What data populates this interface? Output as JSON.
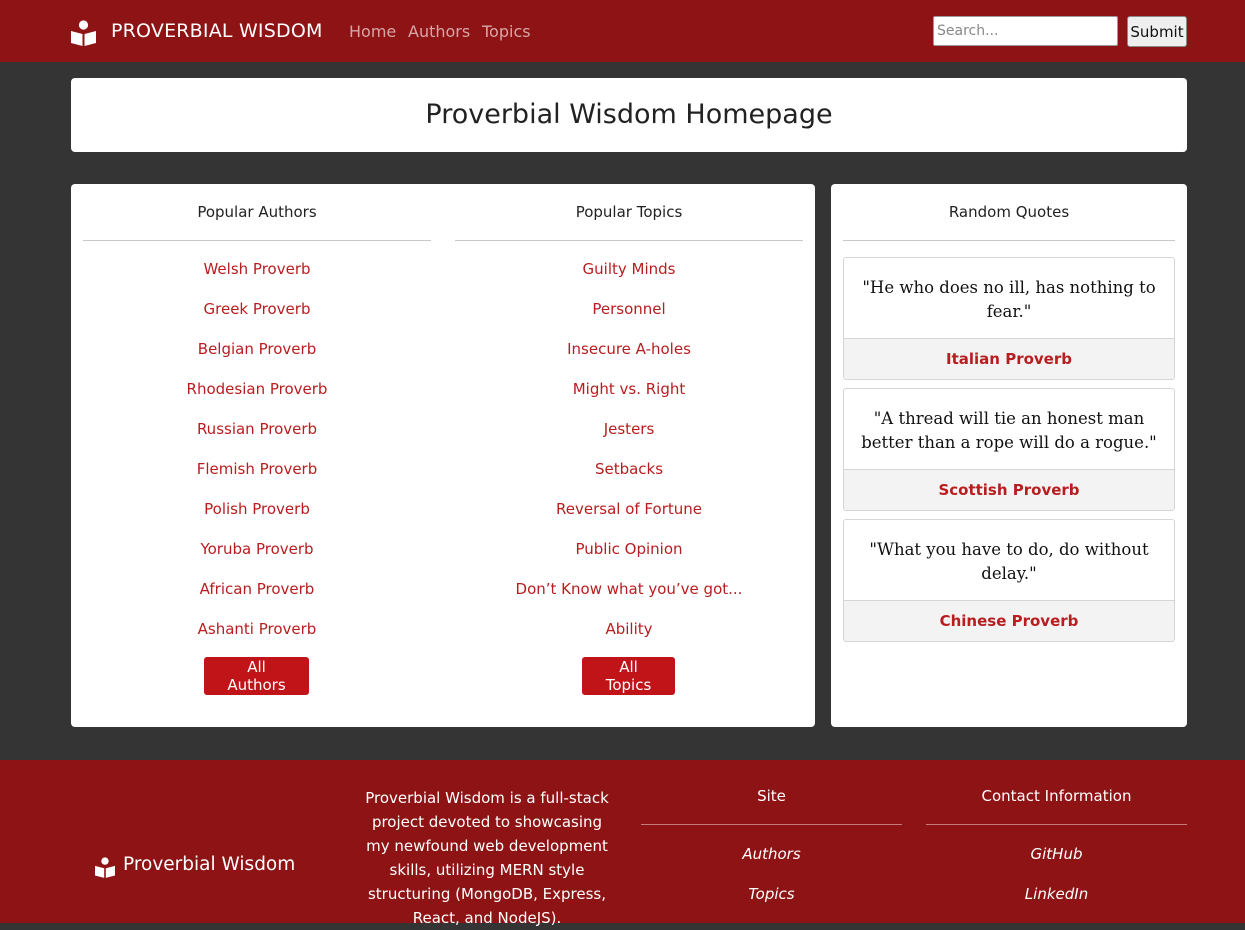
{
  "navbar": {
    "brand": "PROVERBIAL WISDOM",
    "brand_icon": "reader-book-icon",
    "links": [
      "Home",
      "Authors",
      "Topics"
    ],
    "search_placeholder": "Search...",
    "submit_label": "Submit"
  },
  "header": {
    "title": "Proverbial Wisdom Homepage"
  },
  "popular_authors": {
    "heading": "Popular Authors",
    "items": [
      "Welsh Proverb",
      "Greek Proverb",
      "Belgian Proverb",
      "Rhodesian Proverb",
      "Russian Proverb",
      "Flemish Proverb",
      "Polish Proverb",
      "Yoruba Proverb",
      "African Proverb",
      "Ashanti Proverb"
    ],
    "button": "All Authors"
  },
  "popular_topics": {
    "heading": "Popular Topics",
    "items": [
      "Guilty Minds",
      "Personnel",
      "Insecure A-holes",
      "Might vs. Right",
      "Jesters",
      "Setbacks",
      "Reversal of Fortune",
      "Public Opinion",
      "Don’t Know what you’ve got...",
      "Ability"
    ],
    "button": "All Topics"
  },
  "random_quotes": {
    "heading": "Random Quotes",
    "quotes": [
      {
        "text": "\"He who does no ill, has nothing to fear.\"",
        "author": "Italian Proverb"
      },
      {
        "text": "\"A thread will tie an honest man better than a rope will do a rogue.\"",
        "author": "Scottish Proverb"
      },
      {
        "text": "\"What you have to do, do without delay.\"",
        "author": "Chinese Proverb"
      }
    ]
  },
  "footer": {
    "brand": "Proverbial Wisdom",
    "about": "Proverbial Wisdom is a full-stack project devoted to showcasing my newfound web development skills, utilizing MERN style structuring (MongoDB, Express, React, and NodeJS).",
    "site": {
      "heading": "Site",
      "links": [
        "Authors",
        "Topics"
      ]
    },
    "contact": {
      "heading": "Contact Information",
      "links": [
        "GitHub",
        "LinkedIn"
      ]
    }
  },
  "colors": {
    "brand_red": "#8e1314",
    "link_red": "#b81d1f",
    "button_red": "#c01418",
    "page_background": "#343434"
  }
}
